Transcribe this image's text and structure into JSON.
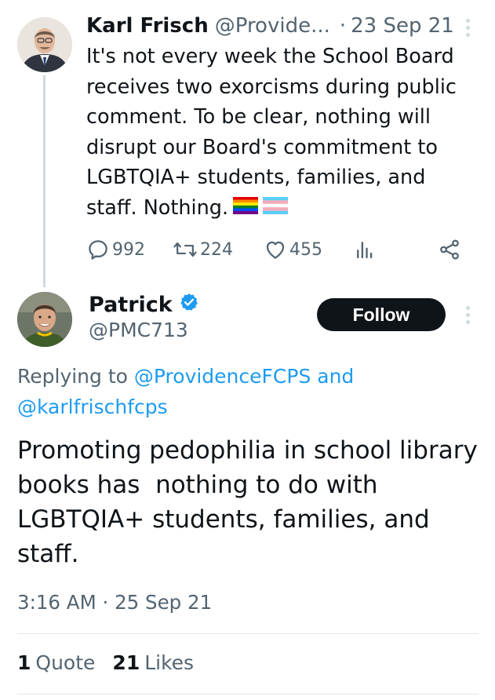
{
  "parent_tweet": {
    "author_name": "Karl Frisch",
    "author_handle": "@Provide...",
    "separator": "·",
    "date": "23 Sep 21",
    "text": "It's not every week the School Board receives two exorcisms during public comment. To be clear, nothing will disrupt our Board's commitment to LGBTQIA+ students, families, and staff. Nothing.",
    "flags": [
      "rainbow-flag-emoji",
      "transgender-flag-emoji"
    ],
    "stats": {
      "replies": "992",
      "retweets": "224",
      "likes": "455"
    }
  },
  "reply_tweet": {
    "author_name": "Patrick",
    "author_handle": "@PMC713",
    "verified": true,
    "follow_label": "Follow",
    "replying_prefix": "Replying to",
    "replying_first": "@ProvidenceFCPS",
    "replying_and": "and",
    "replying_second": "@karlfrischfcps",
    "text": "Promoting pedophilia in school library books has  nothing to do with LGBTQIA+ students, families, and staff.",
    "timestamp": "3:16 AM · 25 Sep 21",
    "quotes_count": "1",
    "quotes_label": "Quote",
    "likes_count": "21",
    "likes_label": "Likes"
  },
  "colors": {
    "text_primary": "#0f1419",
    "text_secondary": "#536471",
    "link": "#1d9bf0",
    "verified_badge": "#1d9bf0",
    "follow_button_bg": "#0f1419",
    "thread_line": "#cfd9de"
  },
  "icons": [
    "reply-icon",
    "retweet-icon",
    "like-icon",
    "views-icon",
    "share-icon",
    "more-icon",
    "verified-badge-icon"
  ]
}
